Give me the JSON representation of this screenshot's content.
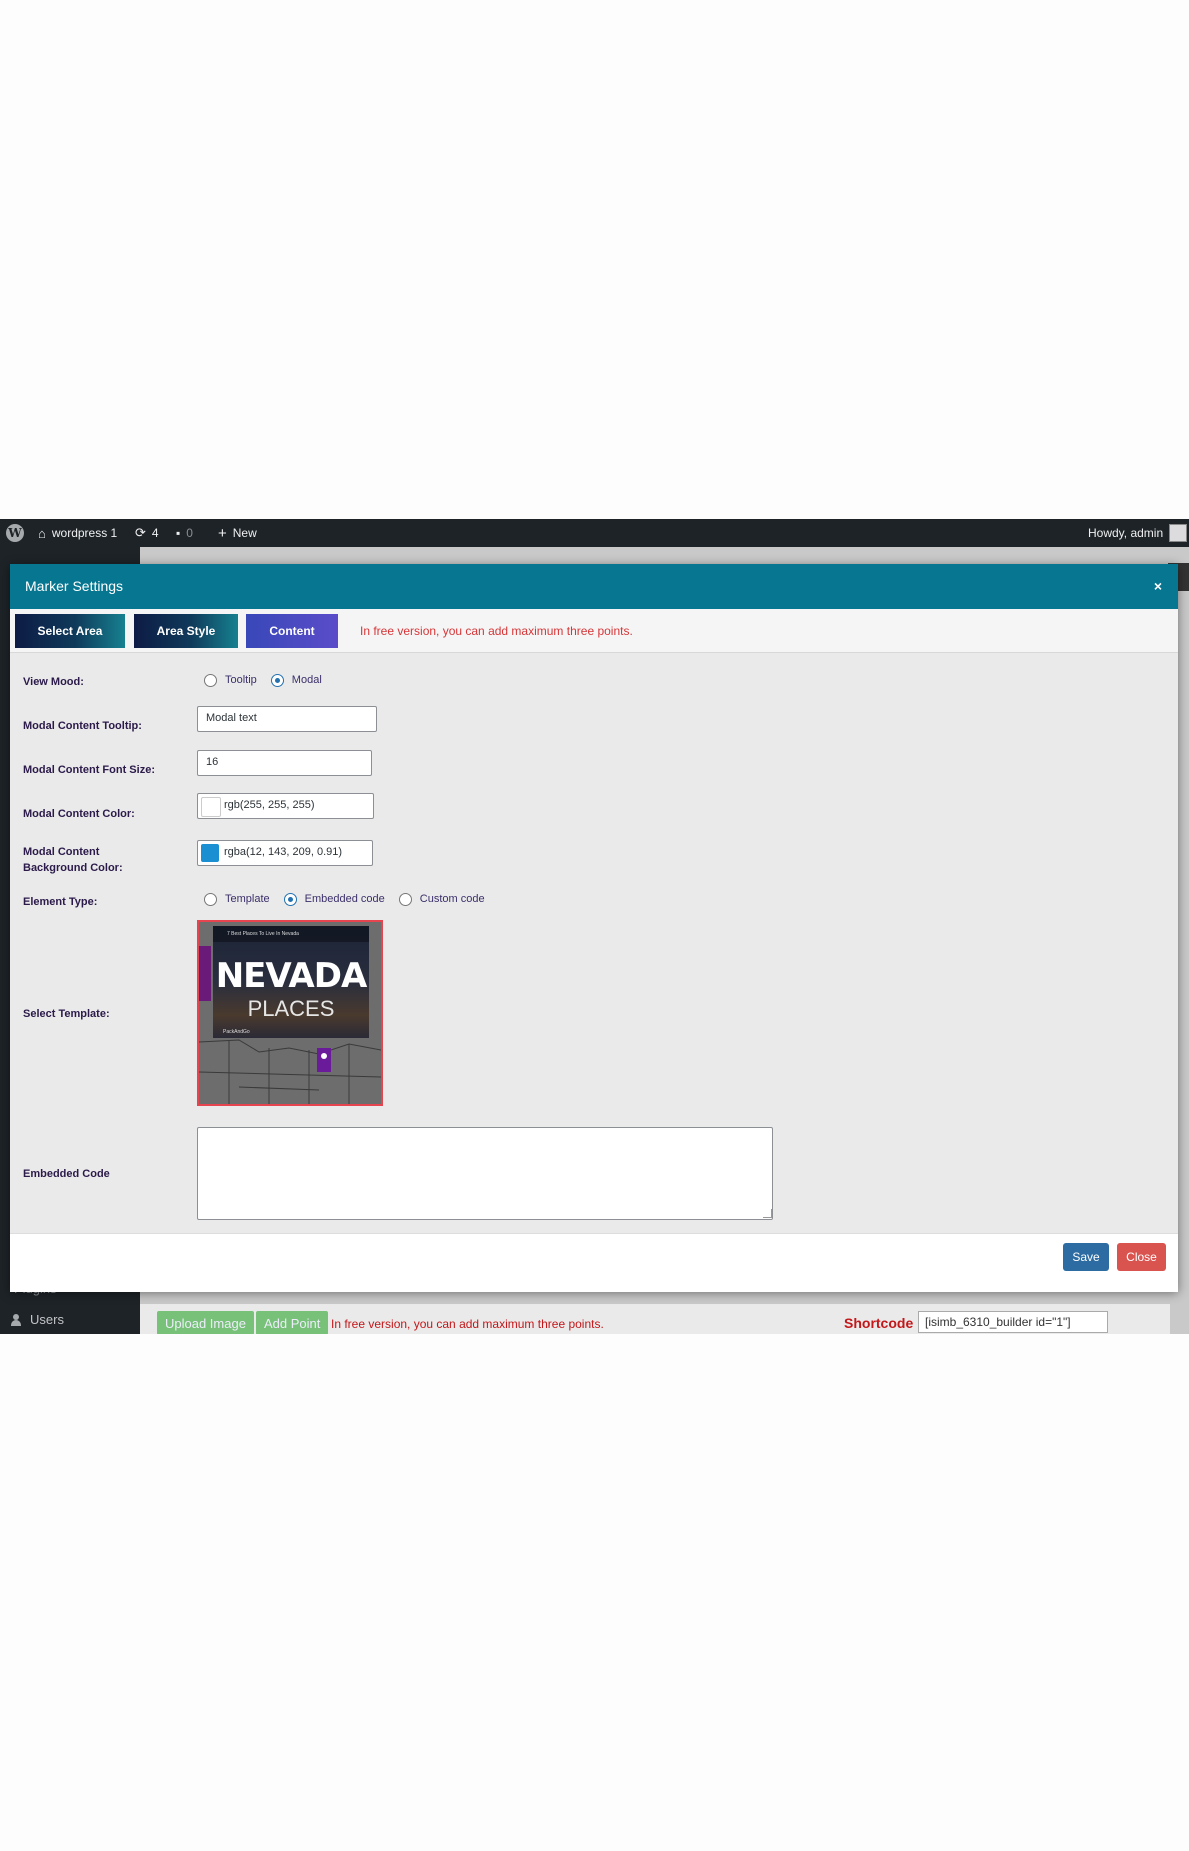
{
  "admin_bar": {
    "site_name": "wordpress 1",
    "updates_count": "4",
    "comments_count": "0",
    "new_label": "New",
    "howdy": "Howdy, admin"
  },
  "background": {
    "plugins_label": "Plugins",
    "users_label": "Users",
    "upload_image_label": "Upload Image",
    "add_point_label": "Add Point",
    "free_note": "In free version, you can add maximum three points.",
    "shortcode_label": "Shortcode",
    "shortcode_value": "[isimb_6310_builder id=\"1\"]"
  },
  "modal": {
    "title": "Marker Settings",
    "close_symbol": "×",
    "tabs": [
      {
        "label": "Select Area"
      },
      {
        "label": "Area Style"
      },
      {
        "label": "Content"
      }
    ],
    "free_note": "In free version, you can add maximum three points.",
    "fields": {
      "view_mood": {
        "label": "View Mood:",
        "options": [
          "Tooltip",
          "Modal"
        ],
        "selected": "Modal"
      },
      "modal_tooltip": {
        "label": "Modal Content Tooltip:",
        "value": "Modal text"
      },
      "font_size": {
        "label": "Modal Content Font Size:",
        "value": "16"
      },
      "content_color": {
        "label": "Modal Content Color:",
        "value": "rgb(255, 255, 255)",
        "swatch": "#ffffff"
      },
      "bg_color": {
        "label_line1": "Modal Content",
        "label_line2": "Background Color:",
        "value": "rgba(12, 143, 209, 0.91)",
        "swatch": "#1a8fd1"
      },
      "element_type": {
        "label": "Element Type:",
        "options": [
          "Template",
          "Embedded code",
          "Custom code"
        ],
        "selected": "Embedded code"
      },
      "select_template": {
        "label": "Select Template:",
        "thumb_title1": "NEVADA",
        "thumb_title2": "PLACES",
        "thumb_caption": "7 Best Places To Live In Nevada",
        "thumb_channel": "PackAndGo"
      },
      "embedded_code": {
        "label": "Embedded Code",
        "value": ""
      }
    },
    "save_label": "Save",
    "close_label": "Close"
  },
  "colors": {
    "header": "#077691",
    "save": "#2d6ca2",
    "close": "#d9534f",
    "note": "#d63638"
  }
}
